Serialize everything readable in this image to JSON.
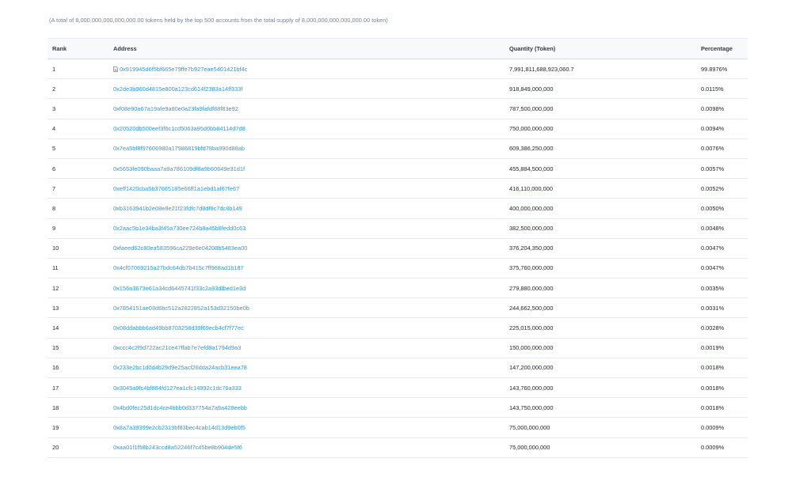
{
  "summary": "(A total of 8,000,000,000,000,000.00 tokens held by the top 500 accounts from the total supply of 8,000,000,000,000,000.00 token)",
  "table": {
    "headers": {
      "rank": "Rank",
      "address": "Address",
      "quantity": "Quantity (Token)",
      "percentage": "Percentage"
    },
    "rows": [
      {
        "rank": "1",
        "address": "0x919945d6f5bf665e79ffe7b927eae5401421bf4c",
        "quantity": "7,991,811,688,923,060.7",
        "percentage": "99.8976%",
        "icon": "contract-icon"
      },
      {
        "rank": "2",
        "address": "0x2de3b960d4815e800a123cd614f2383a14ff333f",
        "quantity": "918,849,000,000",
        "percentage": "0.0115%"
      },
      {
        "rank": "3",
        "address": "0xf08e90a67a19afe9a80e0a23fa9fafdf88f83e92",
        "quantity": "787,500,000,000",
        "percentage": "0.0098%"
      },
      {
        "rank": "4",
        "address": "0x20520db500eef3f6c1cd5063a95d0bb84114d7d8",
        "quantity": "750,000,000,000",
        "percentage": "0.0094%"
      },
      {
        "rank": "5",
        "address": "0x7ea5bf8f97606980a17986819bfd78ba990d88ab",
        "quantity": "609,386,250,000",
        "percentage": "0.0076%"
      },
      {
        "rank": "6",
        "address": "0x5653fe090baaa7a9a786109df8a9b60649e31d1f",
        "quantity": "455,884,500,000",
        "percentage": "0.0057%"
      },
      {
        "rank": "7",
        "address": "0xeff1420cba5b37665185e66ff1a1ebd1af67fe67",
        "quantity": "416,110,000,000",
        "percentage": "0.0052%"
      },
      {
        "rank": "8",
        "address": "0xb3163941b2e08e8e21f23fdfc7d8df9c7dc8b149",
        "quantity": "400,000,000,000",
        "percentage": "0.0050%"
      },
      {
        "rank": "9",
        "address": "0x2aac5b1e34ba3f45a730ee724b8a45b8fedd0c63",
        "quantity": "382,500,000,000",
        "percentage": "0.0048%"
      },
      {
        "rank": "10",
        "address": "0xfaeed62c80ea583596ca229e6e04208b5483ea00",
        "quantity": "376,204,350,000",
        "percentage": "0.0047%"
      },
      {
        "rank": "11",
        "address": "0x4cf07069215a27bdc64db7b415c7ff968ad1b187",
        "quantity": "375,760,000,000",
        "percentage": "0.0047%"
      },
      {
        "rank": "12",
        "address": "0x156a3673e61a34cd6445741f33c2a93dfbed1e3d",
        "quantity": "279,880,000,000",
        "percentage": "0.0035%"
      },
      {
        "rank": "13",
        "address": "0x7854151ae03d6bc512a2822852a153d32150be0b",
        "quantity": "244,662,500,000",
        "percentage": "0.0031%"
      },
      {
        "rank": "14",
        "address": "0x08ddabbb6ad49bb8703258d39f69ecb4cf7f77ec",
        "quantity": "225,015,000,000",
        "percentage": "0.0028%"
      },
      {
        "rank": "15",
        "address": "0xccc4c2f9d722ac21ce47ffab7e7efd8a1794d9a3",
        "quantity": "150,000,000,000",
        "percentage": "0.0019%"
      },
      {
        "rank": "16",
        "address": "0x233e2bc1d0d4b29d9e25acf26dda24acb31eea78",
        "quantity": "147,200,000,000",
        "percentage": "0.0018%"
      },
      {
        "rank": "17",
        "address": "0x3045a9fc4bf884fd127ea1cfc14992c1dc76a333",
        "quantity": "143,760,000,000",
        "percentage": "0.0018%"
      },
      {
        "rank": "18",
        "address": "0x4bd0fec25d1dc4ce4bbb0d337754a7a9a428eebb",
        "quantity": "143,750,000,000",
        "percentage": "0.0018%"
      },
      {
        "rank": "19",
        "address": "0x8a7a39399e2cb2319bf83bec4cab14d13d9eb0f5",
        "quantity": "75,000,000,000",
        "percentage": "0.0009%"
      },
      {
        "rank": "20",
        "address": "0xaa01f1f58b243ccd8a52246f7c45be8b904de5f6",
        "quantity": "75,000,000,000",
        "percentage": "0.0009%"
      }
    ]
  },
  "colors": {
    "link": "#3498db",
    "text": "#1e2022",
    "muted": "#77838f",
    "border": "#e7eaf3"
  }
}
